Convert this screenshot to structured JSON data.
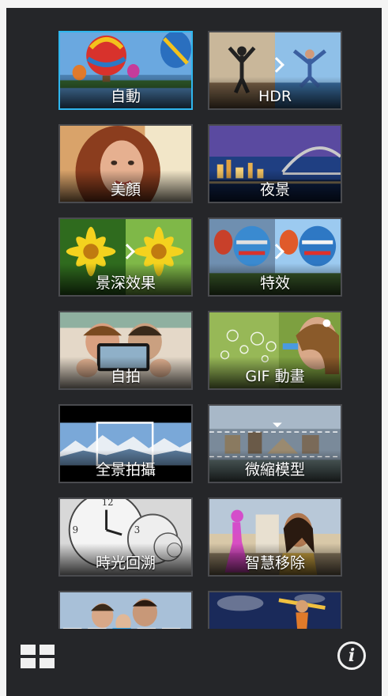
{
  "modes": [
    {
      "label": "自動",
      "icon": "hot-air-balloon-icon",
      "selected": true
    },
    {
      "label": "HDR",
      "icon": "hdr-jump-icon"
    },
    {
      "label": "美顏",
      "icon": "portrait-icon"
    },
    {
      "label": "夜景",
      "icon": "night-bridge-icon"
    },
    {
      "label": "景深效果",
      "icon": "daisy-icon"
    },
    {
      "label": "特效",
      "icon": "balloon-effect-icon"
    },
    {
      "label": "自拍",
      "icon": "selfie-icon"
    },
    {
      "label": "GIF 動畫",
      "icon": "bubbles-icon"
    },
    {
      "label": "全景拍攝",
      "icon": "panorama-icon"
    },
    {
      "label": "微縮模型",
      "icon": "miniature-icon"
    },
    {
      "label": "時光回溯",
      "icon": "clock-icon"
    },
    {
      "label": "智慧移除",
      "icon": "person-remove-icon"
    },
    {
      "label": "",
      "icon": "group-photo-icon"
    },
    {
      "label": "",
      "icon": "soccer-icon"
    }
  ],
  "bottom_bar": {
    "grid_icon": "grid-view-icon",
    "info_icon": "info-icon",
    "info_glyph": "i"
  },
  "colors": {
    "background": "#252629",
    "selected_border": "#2fb6ee",
    "tile_border": "#4a4b4f"
  }
}
